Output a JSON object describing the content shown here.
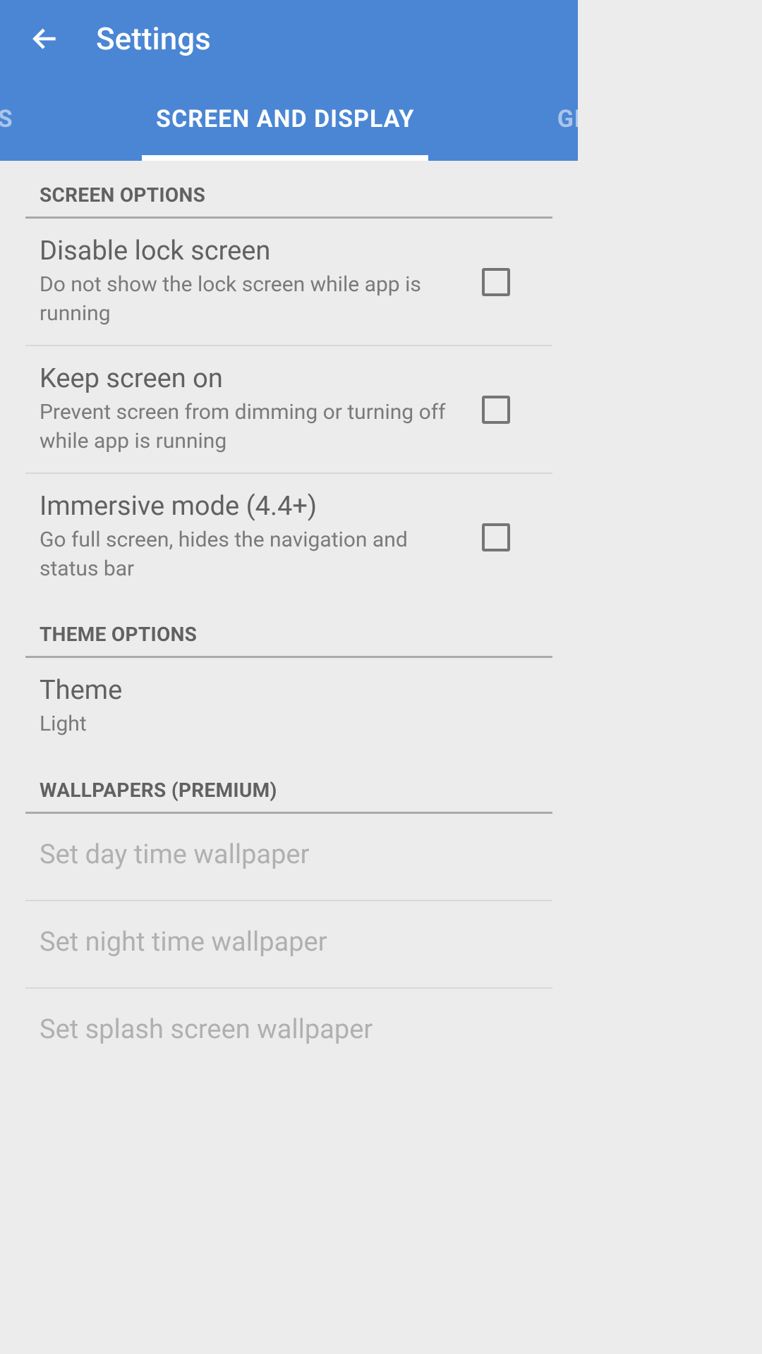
{
  "header": {
    "title": "Settings"
  },
  "tabs": {
    "left": "APS",
    "center": "SCREEN AND DISPLAY",
    "right": "GEN"
  },
  "sections": {
    "screen_options": {
      "header": "SCREEN OPTIONS",
      "items": [
        {
          "title": "Disable lock screen",
          "subtitle": "Do not show the lock screen while app is running",
          "checked": false
        },
        {
          "title": "Keep screen on",
          "subtitle": "Prevent screen from dimming or turning off while app is running",
          "checked": false
        },
        {
          "title": "Immersive mode (4.4+)",
          "subtitle": "Go full screen, hides the navigation and status bar",
          "checked": false
        }
      ]
    },
    "theme_options": {
      "header": "THEME OPTIONS",
      "items": [
        {
          "title": "Theme",
          "subtitle": "Light"
        }
      ]
    },
    "wallpapers": {
      "header": "WALLPAPERS (PREMIUM)",
      "items": [
        {
          "title": "Set day time wallpaper"
        },
        {
          "title": "Set night time wallpaper"
        },
        {
          "title": "Set splash screen wallpaper"
        }
      ]
    }
  }
}
